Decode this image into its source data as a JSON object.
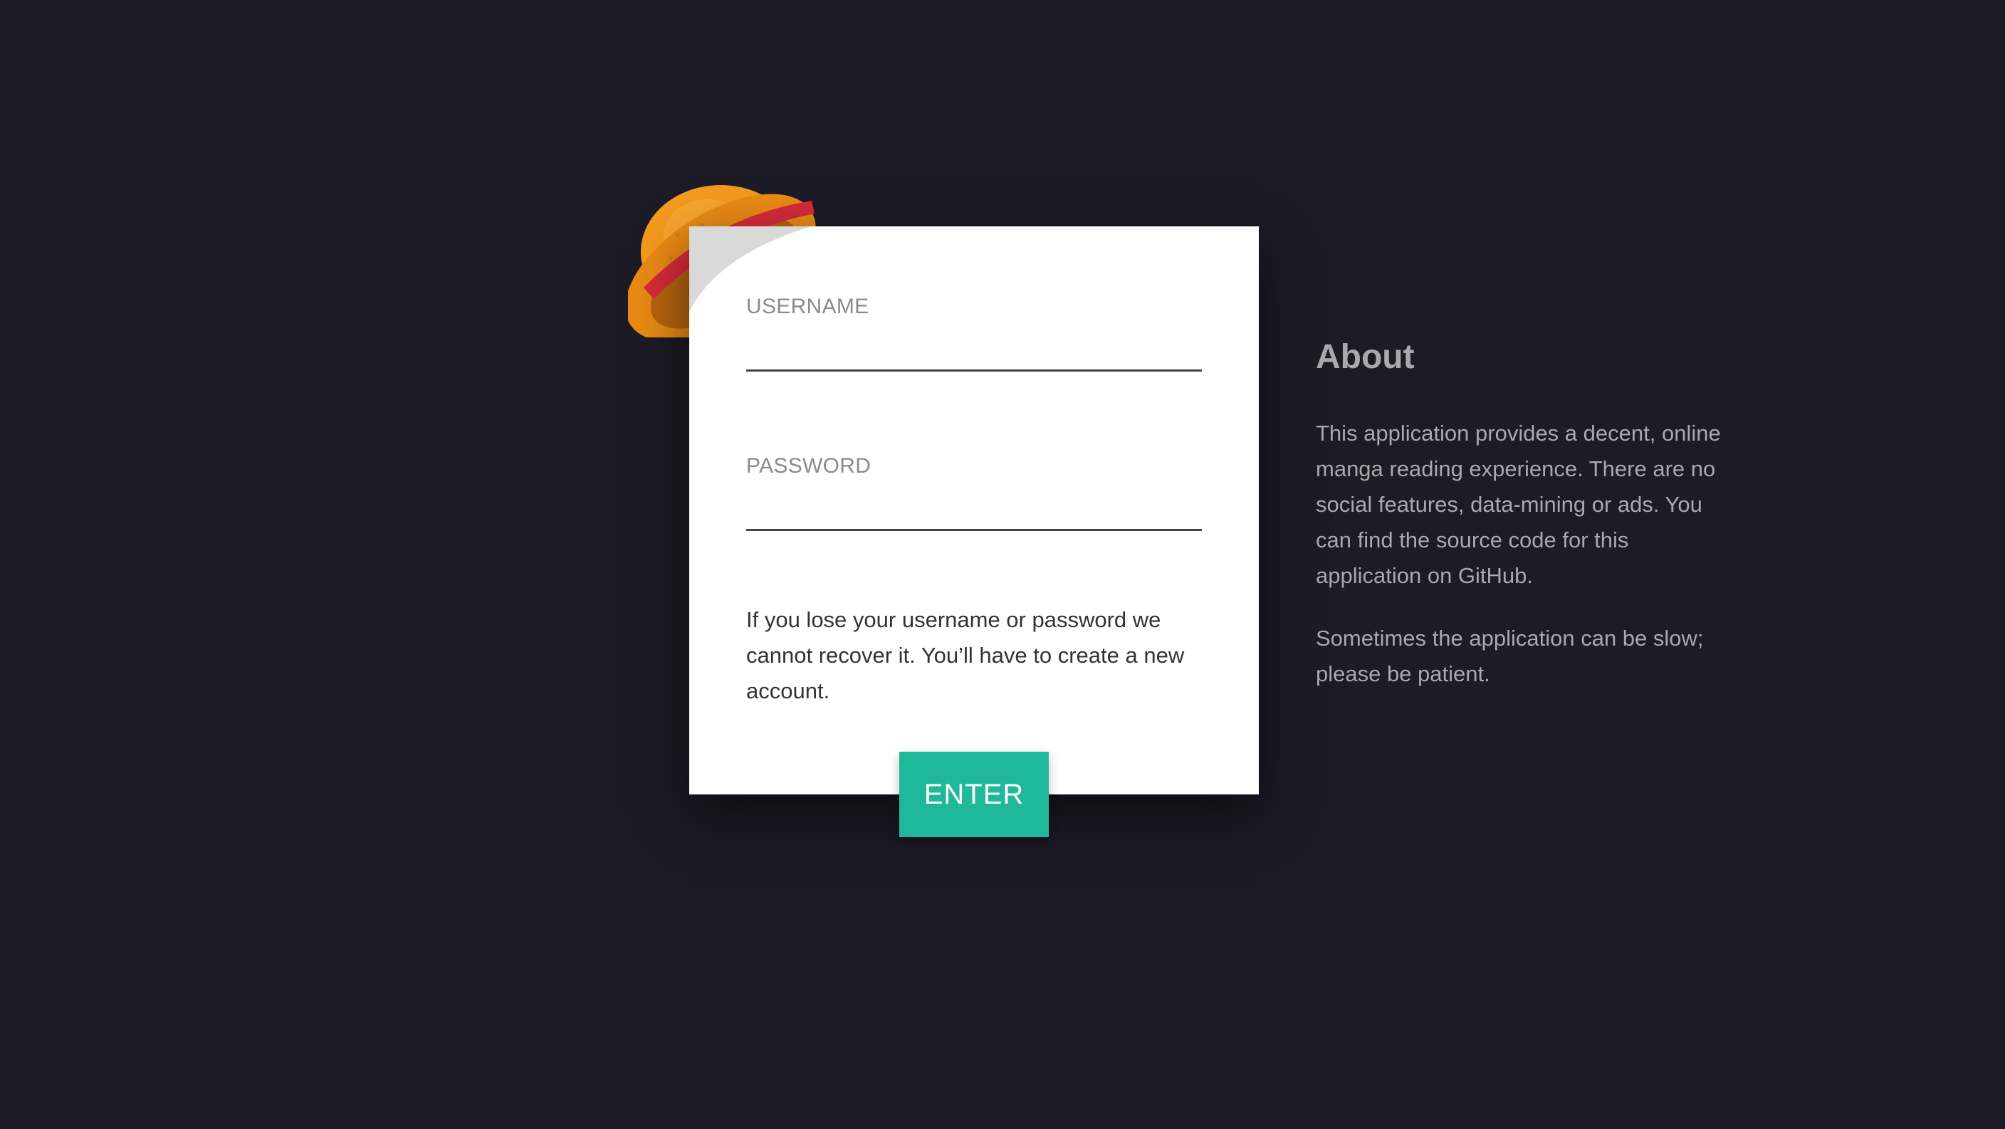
{
  "login": {
    "username_label": "USERNAME",
    "username_value": "",
    "password_label": "PASSWORD",
    "password_value": "",
    "warning": "If you lose your username or password we cannot recover it. You’ll have to create a new account.",
    "submit_label": "ENTER"
  },
  "about": {
    "title": "About",
    "paragraphs": [
      "This application provides a decent, online manga reading experience. There are no social features, data-mining or ads. You can find the source code for this application on GitHub.",
      "Sometimes the application can be slow; please be patient."
    ]
  },
  "icons": {
    "hat": "straw-hat-icon"
  },
  "colors": {
    "background": "#1c1b26",
    "card": "#ffffff",
    "accent": "#1fb89a",
    "hat_straw": "#f0961e",
    "hat_band": "#d62b3a"
  }
}
